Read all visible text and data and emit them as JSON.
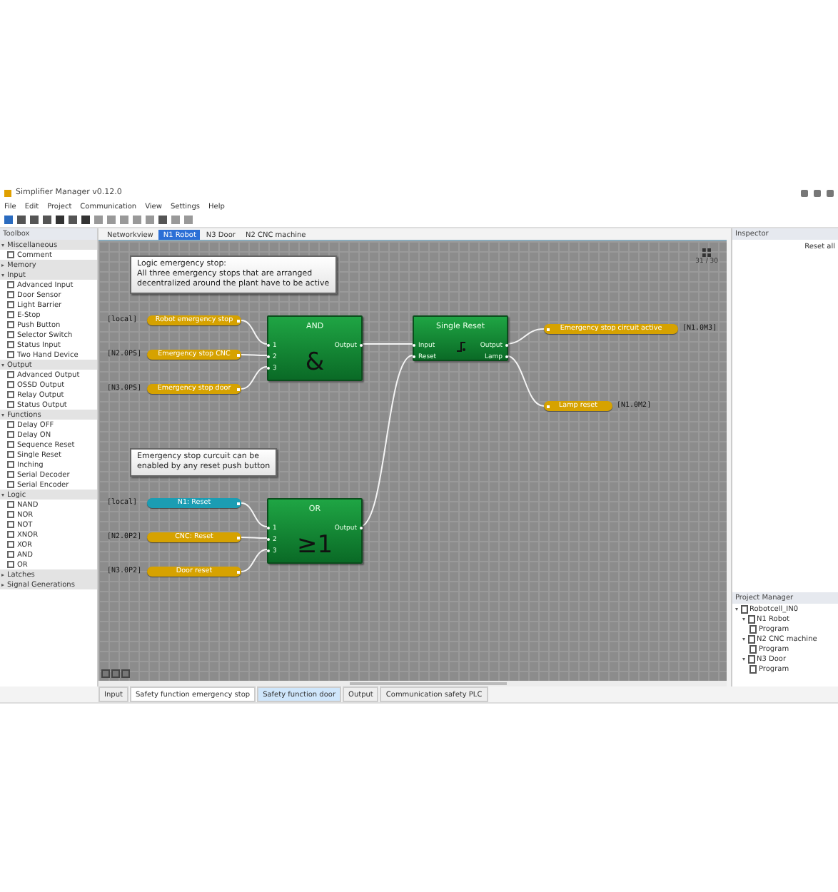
{
  "window": {
    "title": "Simplifier Manager v0.12.0"
  },
  "menu": [
    "File",
    "Edit",
    "Project",
    "Communication",
    "View",
    "Settings",
    "Help"
  ],
  "toolbox": {
    "title": "Toolbox",
    "categories": [
      {
        "label": "Miscellaneous",
        "expanded": true,
        "items": [
          "Comment"
        ]
      },
      {
        "label": "Memory",
        "expanded": false
      },
      {
        "label": "Input",
        "expanded": true,
        "items": [
          "Advanced Input",
          "Door Sensor",
          "Light Barrier",
          "E-Stop",
          "Push Button",
          "Selector Switch",
          "Status Input",
          "Two Hand Device"
        ]
      },
      {
        "label": "Output",
        "expanded": true,
        "items": [
          "Advanced Output",
          "OSSD Output",
          "Relay Output",
          "Status Output"
        ]
      },
      {
        "label": "Functions",
        "expanded": true,
        "items": [
          "Delay OFF",
          "Delay ON",
          "Sequence Reset",
          "Single Reset",
          "Inching",
          "Serial Decoder",
          "Serial Encoder"
        ]
      },
      {
        "label": "Logic",
        "expanded": true,
        "items": [
          "NAND",
          "NOR",
          "NOT",
          "XNOR",
          "XOR",
          "AND",
          "OR"
        ]
      },
      {
        "label": "Latches",
        "expanded": false
      },
      {
        "label": "Signal Generations",
        "expanded": false
      }
    ]
  },
  "document_tabs": [
    {
      "label": "Networkview",
      "selected": false
    },
    {
      "label": "N1 Robot",
      "selected": true
    },
    {
      "label": "N3 Door",
      "selected": false
    },
    {
      "label": "N2 CNC machine",
      "selected": false
    }
  ],
  "canvas": {
    "zoom_label": "31 / 30",
    "comments": [
      {
        "lines": [
          "Logic emergency stop:",
          "All three emergency stops that are arranged",
          "decentralized around the plant have to be active"
        ]
      },
      {
        "lines": [
          "Emergency stop curcuit can be",
          "enabled by any reset push button"
        ]
      }
    ],
    "inputs": [
      {
        "address": "[local]",
        "text": "Robot emergency stop",
        "color": "#d6a200"
      },
      {
        "address": "[N2.0PS]",
        "text": "Emergency stop CNC",
        "color": "#d6a200"
      },
      {
        "address": "[N3.0PS]",
        "text": "Emergency stop door",
        "color": "#d6a200"
      },
      {
        "address": "[local]",
        "text": "N1: Reset",
        "color": "#1b9db3"
      },
      {
        "address": "[N2.0P2]",
        "text": "CNC: Reset",
        "color": "#d6a200"
      },
      {
        "address": "[N3.0P2]",
        "text": "Door reset",
        "color": "#d6a200"
      }
    ],
    "blocks": [
      {
        "kind": "logic",
        "title": "AND",
        "symbol": "&",
        "inputs": [
          "1",
          "2",
          "3"
        ],
        "outputs": [
          "Output"
        ]
      },
      {
        "kind": "function",
        "title": "Single Reset",
        "inputs": [
          "Input",
          "Reset"
        ],
        "outputs": [
          "Output",
          "Lamp"
        ]
      },
      {
        "kind": "logic",
        "title": "OR",
        "symbol": "≥1",
        "inputs": [
          "1",
          "2",
          "3"
        ],
        "outputs": [
          "Output"
        ]
      }
    ],
    "outputs": [
      {
        "text": "Emergency stop circuit active",
        "address": "[N1.0M3]",
        "color": "#d6a200"
      },
      {
        "text": "Lamp reset",
        "address": "[N1.0M2]",
        "color": "#d6a200"
      }
    ]
  },
  "inspector": {
    "title": "Inspector",
    "reset_label": "Reset all"
  },
  "project_manager": {
    "title": "Project Manager",
    "tree": [
      {
        "label": "Robotcell_IN0",
        "expanded": true,
        "children": [
          {
            "label": "N1 Robot",
            "expanded": true,
            "children": [
              {
                "label": "Program"
              }
            ]
          },
          {
            "label": "N2 CNC machine",
            "expanded": true,
            "children": [
              {
                "label": "Program"
              }
            ]
          },
          {
            "label": "N3 Door",
            "expanded": true,
            "children": [
              {
                "label": "Program"
              }
            ]
          }
        ]
      }
    ]
  },
  "bottom_tabs": [
    {
      "label": "Input",
      "selected": false,
      "highlighted": false
    },
    {
      "label": "Safety function emergency stop",
      "selected": true,
      "highlighted": false
    },
    {
      "label": "Safety function door",
      "selected": false,
      "highlighted": true
    },
    {
      "label": "Output",
      "selected": false,
      "highlighted": false
    },
    {
      "label": "Communication safety PLC",
      "selected": false,
      "highlighted": false
    }
  ]
}
